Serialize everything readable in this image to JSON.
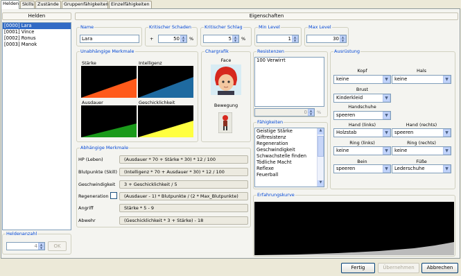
{
  "tabs": [
    "Helden",
    "Skills",
    "Zustände",
    "Gruppenfähigkeiten",
    "Einzelfähigkeiten"
  ],
  "heroes": {
    "header": "Helden",
    "items": [
      "[0000] Lara",
      "[0001] Vince",
      "[0002] Ronus",
      "[0003] Manok"
    ],
    "count_label": "Heldenanzahl",
    "count_value": "4",
    "ok": "OK"
  },
  "props": {
    "header": "Eigenschaften",
    "name": {
      "legend": "Name",
      "value": "Lara"
    },
    "crit_damage": {
      "legend": "Kritischer Schaden",
      "prefix": "+",
      "value": "50",
      "unit": "%"
    },
    "crit_hit": {
      "legend": "Kritischer Schlag",
      "value": "5",
      "unit": "%"
    },
    "min_level": {
      "legend": "Min Level",
      "value": "1"
    },
    "max_level": {
      "legend": "Max Level",
      "value": "30"
    },
    "independent": {
      "legend": "Unabhängige Merkmale",
      "graphs": [
        "Stärke",
        "Intelligenz",
        "Ausdauer",
        "Geschicklichkeit"
      ],
      "colors": [
        "#ff5a1a",
        "#1e6aa0",
        "#1a9a1a",
        "#ffff40"
      ]
    },
    "charset": {
      "legend": "Chargrafik",
      "face": "Face",
      "movement": "Bewegung"
    },
    "resist": {
      "legend": "Resistenzen",
      "items": [
        "100 Verwirrt"
      ],
      "value": "0",
      "unit": "%"
    },
    "skills": {
      "legend": "Fähigkeiten",
      "items": [
        "Geistige Stärke",
        "Giftresistenz",
        "Regeneration",
        "Geschwindigkeit",
        "Schwachstelle finden",
        "Tödliche Macht",
        "Reflexe",
        "Feuerball"
      ]
    },
    "equip": {
      "legend": "Ausrüstung",
      "kopf": {
        "label": "Kopf",
        "value": "keine"
      },
      "hals": {
        "label": "Hals",
        "value": "keine"
      },
      "brust": {
        "label": "Brust",
        "value": "Kinderkleid"
      },
      "handschuhe": {
        "label": "Handschuhe",
        "value": "speeren"
      },
      "hand_l": {
        "label": "Hand (links)",
        "value": "Holzstab"
      },
      "hand_r": {
        "label": "Hand (rechts)",
        "value": "speeren"
      },
      "ring_l": {
        "label": "Ring (links)",
        "value": "keine"
      },
      "ring_r": {
        "label": "Ring (rechts)",
        "value": "keine"
      },
      "bein": {
        "label": "Bein",
        "value": "speeren"
      },
      "fuesse": {
        "label": "Füße",
        "value": "Lederschuhe"
      }
    },
    "dependent": {
      "legend": "Abhängige Merkmale",
      "rows": [
        {
          "label": "HP (Leben)",
          "formula": "(Ausdauer * 70 + Stärke * 30) * 12 / 100"
        },
        {
          "label": "Blutpunkte (Skill)",
          "formula": "(Intelligenz * 70 + Ausdauer * 30) * 12 / 100"
        },
        {
          "label": "Geschwindigkeit",
          "formula": "3 + Geschicklichkeit / 5"
        },
        {
          "label": "Regeneration",
          "formula": "(Ausdauer - 1)  * Blutpunkte / (2 *  Max_Blutpunkte)"
        },
        {
          "label": "Angriff",
          "formula": "Stärke * 5 - 9"
        },
        {
          "label": "Abwehr",
          "formula": "(Geschicklichkeit * 3 + Stärke) - 18"
        }
      ]
    },
    "exp": {
      "legend": "Erfahrungskurve"
    }
  },
  "footer": {
    "fertig": "Fertig",
    "apply": "Übernehmen",
    "cancel": "Abbrechen"
  }
}
